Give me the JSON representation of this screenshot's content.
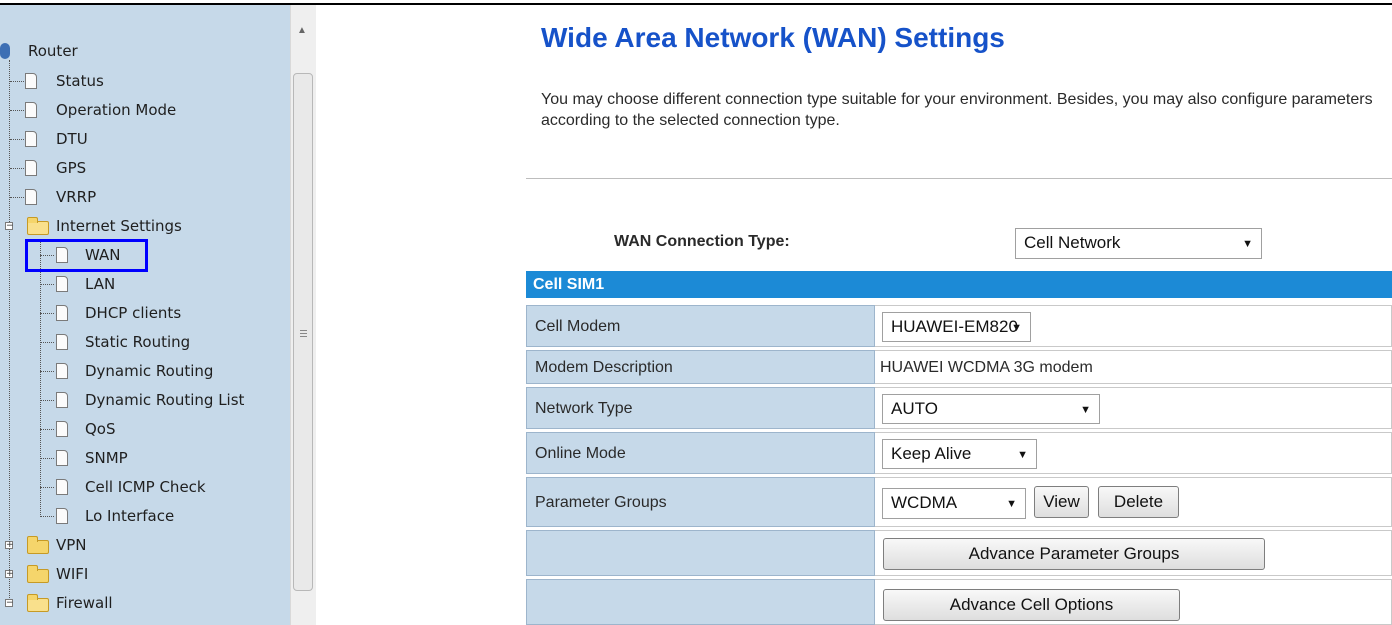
{
  "sidebar": {
    "root_label": "Router",
    "items": [
      {
        "label": "Status"
      },
      {
        "label": "Operation Mode"
      },
      {
        "label": "DTU"
      },
      {
        "label": "GPS"
      },
      {
        "label": "VRRP"
      },
      {
        "label": "Internet Settings"
      },
      {
        "label": "WAN",
        "selected": true
      },
      {
        "label": "LAN"
      },
      {
        "label": "DHCP clients"
      },
      {
        "label": "Static Routing"
      },
      {
        "label": "Dynamic Routing"
      },
      {
        "label": "Dynamic Routing List"
      },
      {
        "label": "QoS"
      },
      {
        "label": "SNMP"
      },
      {
        "label": "Cell ICMP Check"
      },
      {
        "label": "Lo Interface"
      },
      {
        "label": "VPN"
      },
      {
        "label": "WIFI"
      },
      {
        "label": "Firewall"
      }
    ]
  },
  "main": {
    "title": "Wide Area Network (WAN) Settings",
    "description": "You may choose different connection type suitable for your environment. Besides, you may also configure parameters according to the selected connection type.",
    "connection_type_label": "WAN Connection Type:",
    "connection_type_value": "Cell Network",
    "section_header": "Cell SIM1",
    "rows": [
      {
        "label": "Cell Modem",
        "value": "HUAWEI-EM820"
      },
      {
        "label": "Modem Description",
        "value": "HUAWEI WCDMA 3G modem"
      },
      {
        "label": "Network Type",
        "value": "AUTO"
      },
      {
        "label": "Online Mode",
        "value": "Keep Alive"
      },
      {
        "label": "Parameter Groups",
        "value": "WCDMA",
        "view_label": "View",
        "delete_label": "Delete"
      }
    ],
    "advance_parameter_groups_label": "Advance Parameter Groups",
    "advance_cell_options_label": "Advance Cell Options"
  },
  "colors": {
    "sidebar_bg": "#c6d9e9",
    "title": "#1652c9",
    "table_header": "#1c8ad6",
    "selection_box": "#0000ff"
  }
}
